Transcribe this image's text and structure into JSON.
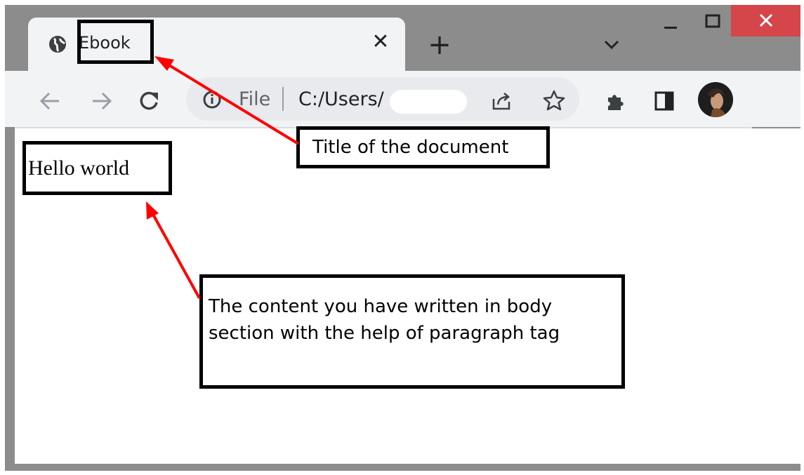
{
  "browser": {
    "tab": {
      "title": "Ebook",
      "close_glyph": "✕"
    },
    "new_tab_glyph": "+",
    "address_bar": {
      "scheme_label": "File",
      "url_visible": "C:/Users/"
    },
    "colors": {
      "frame": "#8c8c8c",
      "toolbar": "#f1f3f4",
      "close_button": "#d4464a"
    }
  },
  "page": {
    "paragraph_text": "Hello world"
  },
  "annotations": {
    "title_callout": "Title of the document",
    "body_callout": "The content you have written in body section with the help of paragraph tag",
    "arrow_color": "#ff0000"
  }
}
